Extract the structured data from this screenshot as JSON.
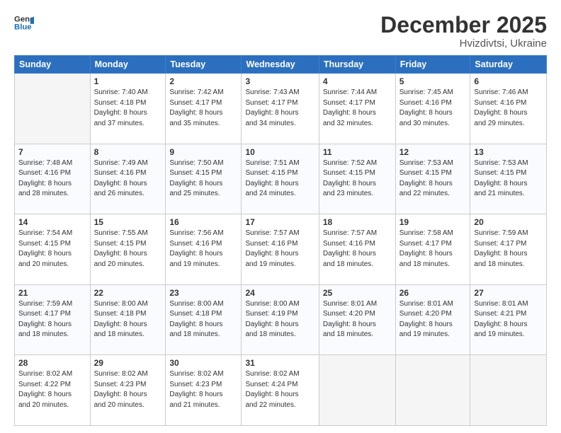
{
  "logo": {
    "line1": "General",
    "line2": "Blue"
  },
  "title": "December 2025",
  "subtitle": "Hvizdivtsi, Ukraine",
  "weekdays": [
    "Sunday",
    "Monday",
    "Tuesday",
    "Wednesday",
    "Thursday",
    "Friday",
    "Saturday"
  ],
  "weeks": [
    [
      {
        "day": "",
        "info": ""
      },
      {
        "day": "1",
        "info": "Sunrise: 7:40 AM\nSunset: 4:18 PM\nDaylight: 8 hours\nand 37 minutes."
      },
      {
        "day": "2",
        "info": "Sunrise: 7:42 AM\nSunset: 4:17 PM\nDaylight: 8 hours\nand 35 minutes."
      },
      {
        "day": "3",
        "info": "Sunrise: 7:43 AM\nSunset: 4:17 PM\nDaylight: 8 hours\nand 34 minutes."
      },
      {
        "day": "4",
        "info": "Sunrise: 7:44 AM\nSunset: 4:17 PM\nDaylight: 8 hours\nand 32 minutes."
      },
      {
        "day": "5",
        "info": "Sunrise: 7:45 AM\nSunset: 4:16 PM\nDaylight: 8 hours\nand 30 minutes."
      },
      {
        "day": "6",
        "info": "Sunrise: 7:46 AM\nSunset: 4:16 PM\nDaylight: 8 hours\nand 29 minutes."
      }
    ],
    [
      {
        "day": "7",
        "info": "Sunrise: 7:48 AM\nSunset: 4:16 PM\nDaylight: 8 hours\nand 28 minutes."
      },
      {
        "day": "8",
        "info": "Sunrise: 7:49 AM\nSunset: 4:16 PM\nDaylight: 8 hours\nand 26 minutes."
      },
      {
        "day": "9",
        "info": "Sunrise: 7:50 AM\nSunset: 4:15 PM\nDaylight: 8 hours\nand 25 minutes."
      },
      {
        "day": "10",
        "info": "Sunrise: 7:51 AM\nSunset: 4:15 PM\nDaylight: 8 hours\nand 24 minutes."
      },
      {
        "day": "11",
        "info": "Sunrise: 7:52 AM\nSunset: 4:15 PM\nDaylight: 8 hours\nand 23 minutes."
      },
      {
        "day": "12",
        "info": "Sunrise: 7:53 AM\nSunset: 4:15 PM\nDaylight: 8 hours\nand 22 minutes."
      },
      {
        "day": "13",
        "info": "Sunrise: 7:53 AM\nSunset: 4:15 PM\nDaylight: 8 hours\nand 21 minutes."
      }
    ],
    [
      {
        "day": "14",
        "info": "Sunrise: 7:54 AM\nSunset: 4:15 PM\nDaylight: 8 hours\nand 20 minutes."
      },
      {
        "day": "15",
        "info": "Sunrise: 7:55 AM\nSunset: 4:15 PM\nDaylight: 8 hours\nand 20 minutes."
      },
      {
        "day": "16",
        "info": "Sunrise: 7:56 AM\nSunset: 4:16 PM\nDaylight: 8 hours\nand 19 minutes."
      },
      {
        "day": "17",
        "info": "Sunrise: 7:57 AM\nSunset: 4:16 PM\nDaylight: 8 hours\nand 19 minutes."
      },
      {
        "day": "18",
        "info": "Sunrise: 7:57 AM\nSunset: 4:16 PM\nDaylight: 8 hours\nand 18 minutes."
      },
      {
        "day": "19",
        "info": "Sunrise: 7:58 AM\nSunset: 4:17 PM\nDaylight: 8 hours\nand 18 minutes."
      },
      {
        "day": "20",
        "info": "Sunrise: 7:59 AM\nSunset: 4:17 PM\nDaylight: 8 hours\nand 18 minutes."
      }
    ],
    [
      {
        "day": "21",
        "info": "Sunrise: 7:59 AM\nSunset: 4:17 PM\nDaylight: 8 hours\nand 18 minutes."
      },
      {
        "day": "22",
        "info": "Sunrise: 8:00 AM\nSunset: 4:18 PM\nDaylight: 8 hours\nand 18 minutes."
      },
      {
        "day": "23",
        "info": "Sunrise: 8:00 AM\nSunset: 4:18 PM\nDaylight: 8 hours\nand 18 minutes."
      },
      {
        "day": "24",
        "info": "Sunrise: 8:00 AM\nSunset: 4:19 PM\nDaylight: 8 hours\nand 18 minutes."
      },
      {
        "day": "25",
        "info": "Sunrise: 8:01 AM\nSunset: 4:20 PM\nDaylight: 8 hours\nand 18 minutes."
      },
      {
        "day": "26",
        "info": "Sunrise: 8:01 AM\nSunset: 4:20 PM\nDaylight: 8 hours\nand 19 minutes."
      },
      {
        "day": "27",
        "info": "Sunrise: 8:01 AM\nSunset: 4:21 PM\nDaylight: 8 hours\nand 19 minutes."
      }
    ],
    [
      {
        "day": "28",
        "info": "Sunrise: 8:02 AM\nSunset: 4:22 PM\nDaylight: 8 hours\nand 20 minutes."
      },
      {
        "day": "29",
        "info": "Sunrise: 8:02 AM\nSunset: 4:23 PM\nDaylight: 8 hours\nand 20 minutes."
      },
      {
        "day": "30",
        "info": "Sunrise: 8:02 AM\nSunset: 4:23 PM\nDaylight: 8 hours\nand 21 minutes."
      },
      {
        "day": "31",
        "info": "Sunrise: 8:02 AM\nSunset: 4:24 PM\nDaylight: 8 hours\nand 22 minutes."
      },
      {
        "day": "",
        "info": ""
      },
      {
        "day": "",
        "info": ""
      },
      {
        "day": "",
        "info": ""
      }
    ]
  ]
}
